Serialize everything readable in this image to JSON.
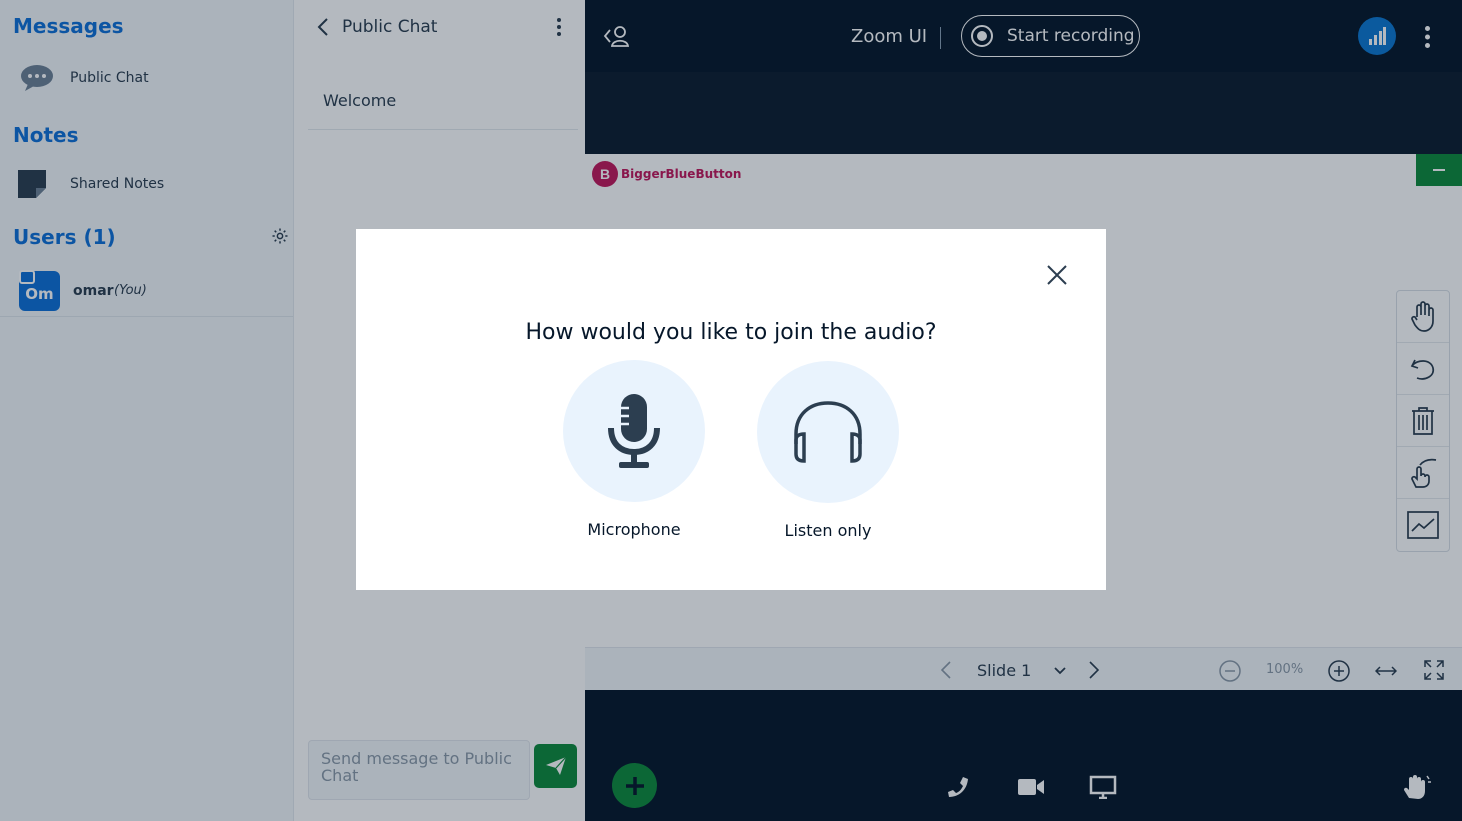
{
  "sidebar": {
    "messages_title": "Messages",
    "public_chat_label": "Public Chat",
    "notes_title": "Notes",
    "shared_notes_label": "Shared Notes",
    "users_title": "Users (1)",
    "user": {
      "avatar_initials": "Om",
      "name": "omar",
      "you_tag": "(You)"
    }
  },
  "chat": {
    "header_title": "Public Chat",
    "welcome": "Welcome",
    "composer_placeholder": "Send message to Public Chat"
  },
  "topbar": {
    "title": "Zoom UI",
    "record_label": "Start recording"
  },
  "presentation": {
    "logo_text": "BiggerBlueButton",
    "slide_label": "Slide 1",
    "zoom_value": "100%"
  },
  "modal": {
    "question": "How would you like to join the audio?",
    "microphone_label": "Microphone",
    "listen_only_label": "Listen only"
  },
  "colors": {
    "brand_blue": "#0f70d7",
    "accent_green": "#0f8a3c",
    "dark_bar": "#06172a",
    "option_bg": "#e9f3fd"
  }
}
